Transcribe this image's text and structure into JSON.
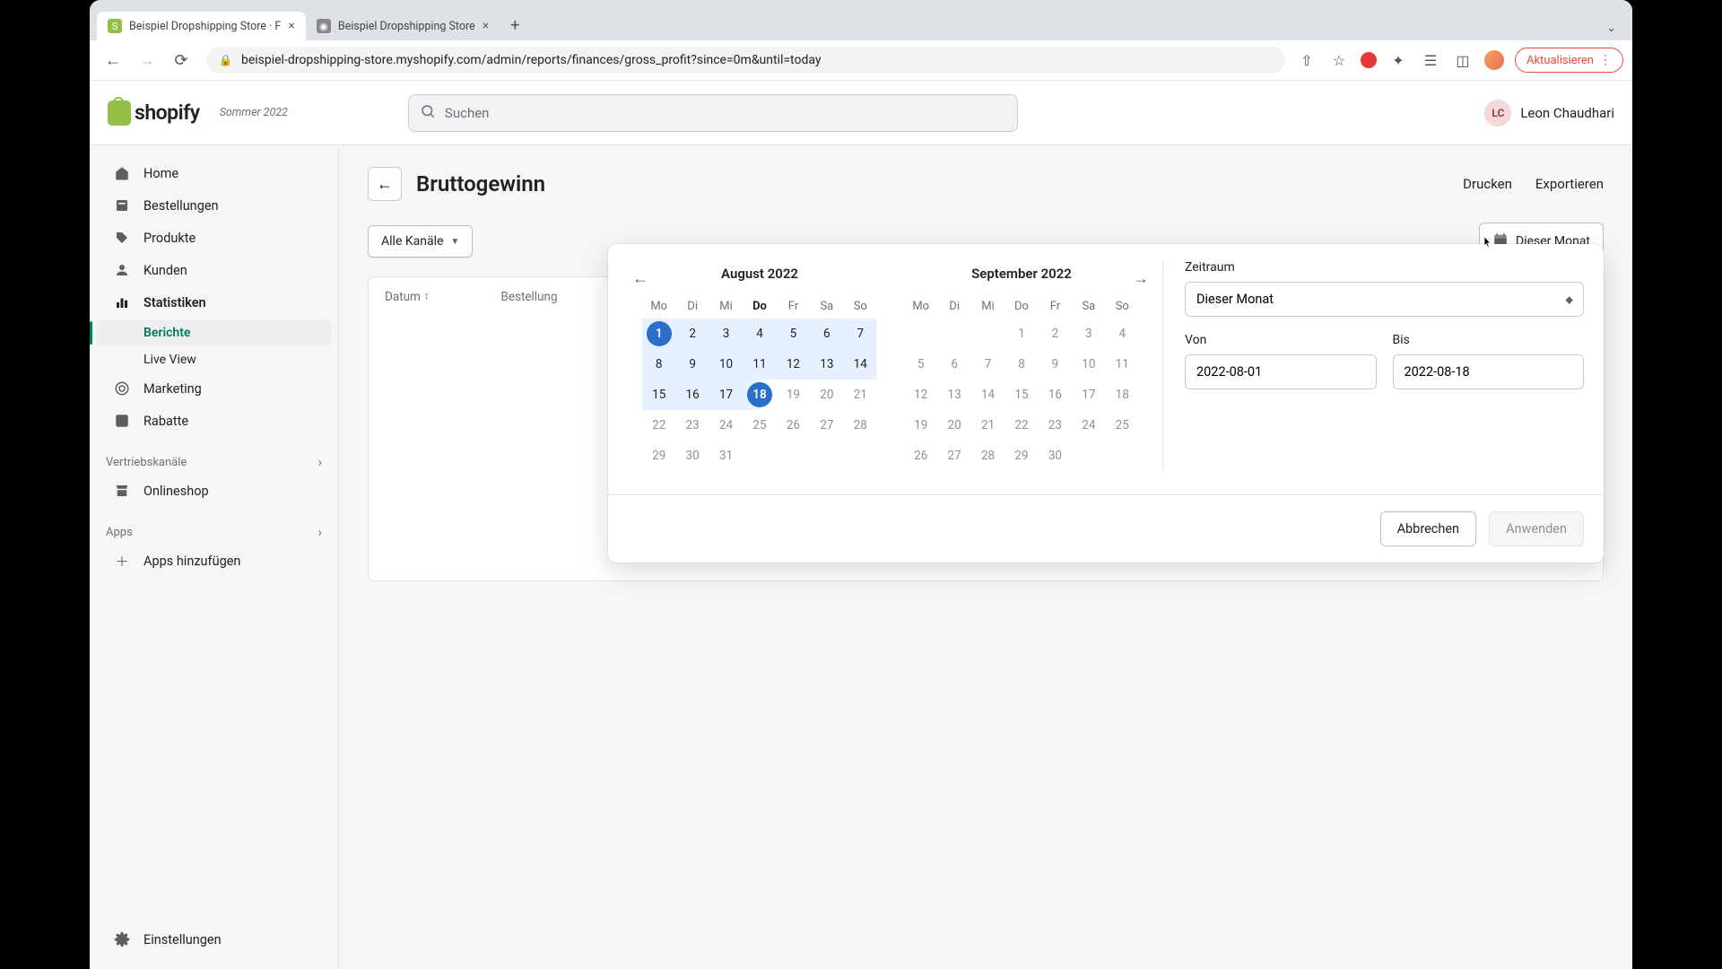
{
  "browser": {
    "tab1": "Beispiel Dropshipping Store · F",
    "tab2": "Beispiel Dropshipping Store",
    "url": "beispiel-dropshipping-store.myshopify.com/admin/reports/finances/gross_profit?since=0m&until=today",
    "update": "Aktualisieren"
  },
  "header": {
    "logo": "shopify",
    "edition": "Sommer 2022",
    "search_placeholder": "Suchen",
    "user_initials": "LC",
    "user_name": "Leon Chaudhari"
  },
  "sidebar": {
    "home": "Home",
    "orders": "Bestellungen",
    "products": "Produkte",
    "customers": "Kunden",
    "analytics": "Statistiken",
    "reports": "Berichte",
    "live": "Live View",
    "marketing": "Marketing",
    "discounts": "Rabatte",
    "sales_channels": "Vertriebskanäle",
    "onlineshop": "Onlineshop",
    "apps": "Apps",
    "add_apps": "Apps hinzufügen",
    "settings": "Einstellungen"
  },
  "page": {
    "title": "Bruttogewinn",
    "print": "Drucken",
    "export": "Exportieren",
    "channels": "Alle Kanäle",
    "date_button": "Dieser Monat",
    "col_date": "Datum",
    "col_order": "Bestellung"
  },
  "popover": {
    "month1_title": "August 2022",
    "month2_title": "September 2022",
    "dow": [
      "Mo",
      "Di",
      "Mi",
      "Do",
      "Fr",
      "Sa",
      "So"
    ],
    "timerange_label": "Zeitraum",
    "timerange_value": "Dieser Monat",
    "from_label": "Von",
    "from_value": "2022-08-01",
    "to_label": "Bis",
    "to_value": "2022-08-18",
    "cancel": "Abbrechen",
    "apply": "Anwenden",
    "month1": {
      "offset": 0,
      "days": 31,
      "today_col": 3,
      "range_start": 1,
      "range_end": 18
    },
    "month2": {
      "offset": 3,
      "days": 30
    }
  }
}
